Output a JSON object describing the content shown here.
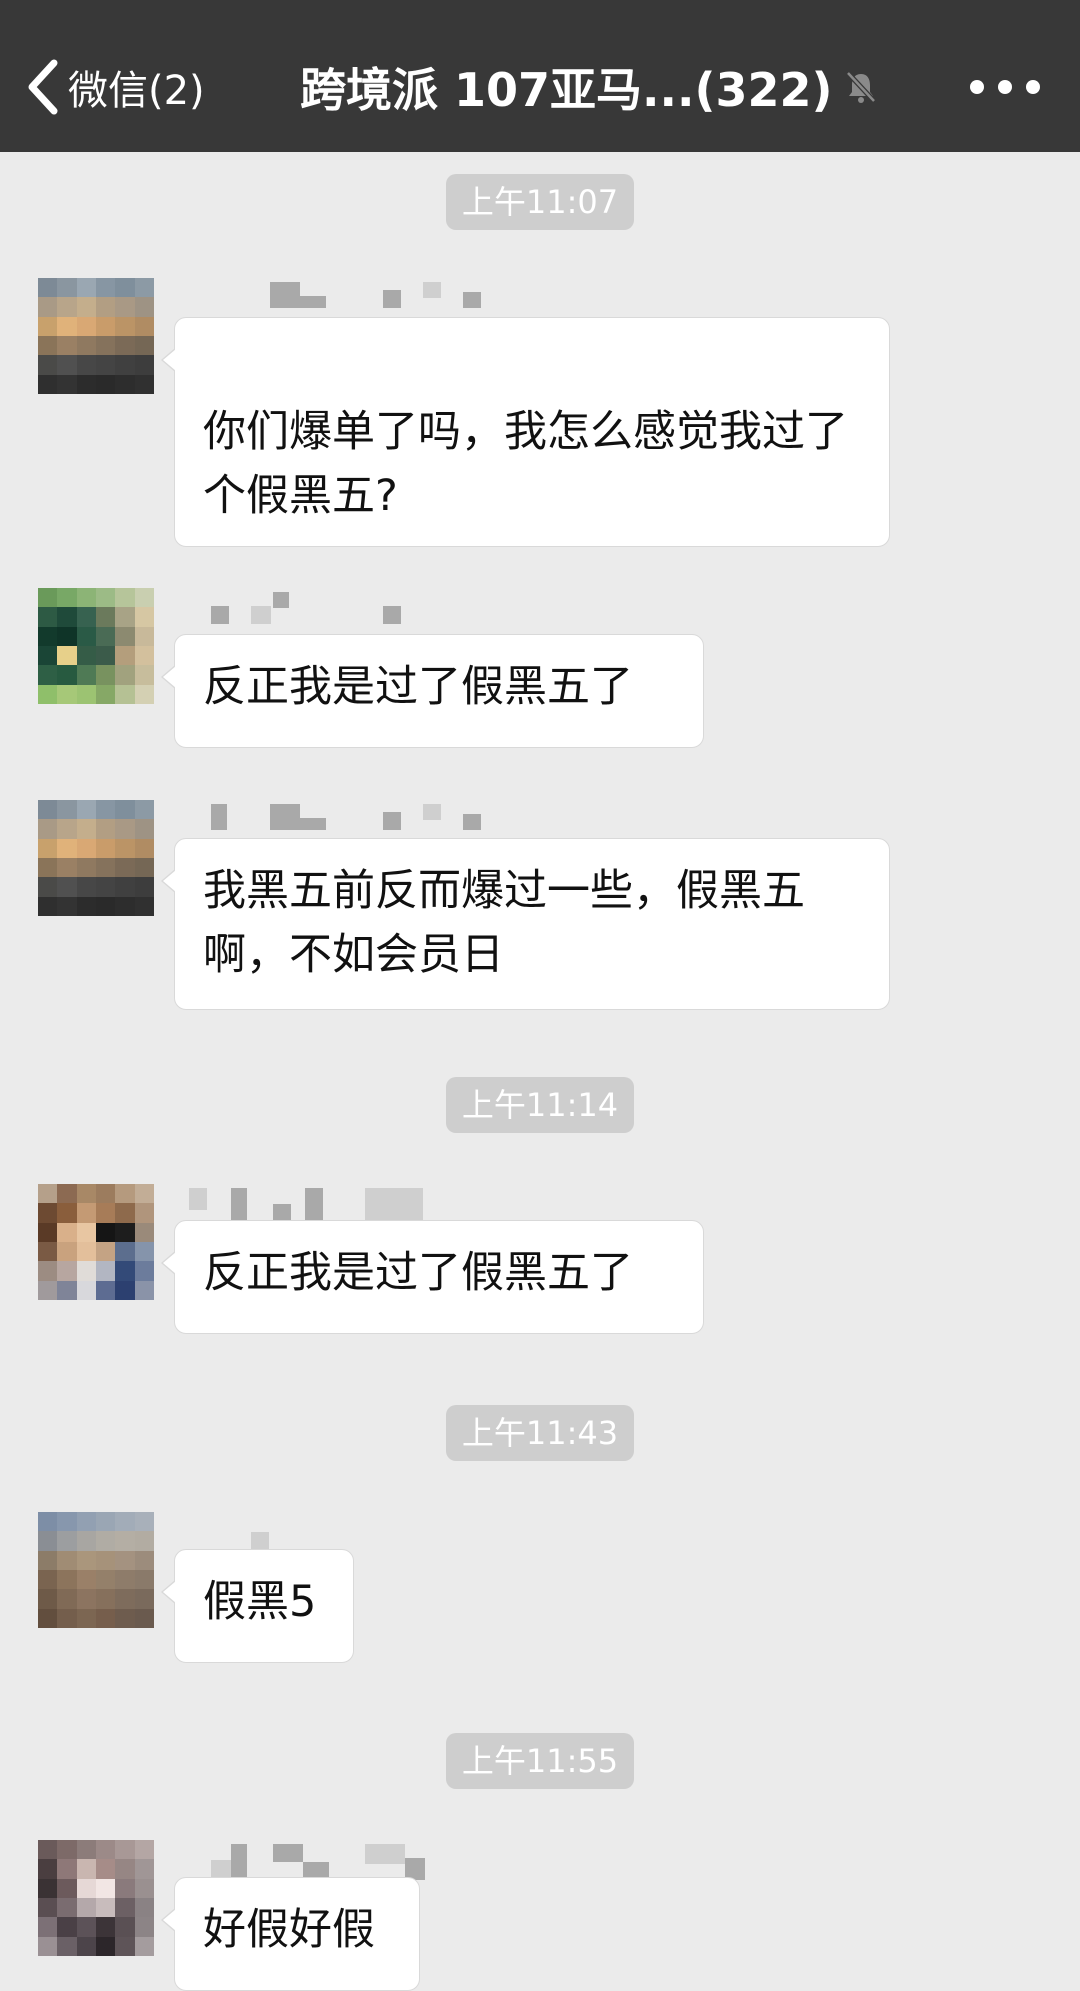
{
  "navbar": {
    "back_label": "微信(2)",
    "title": "跨境派 107亚马...(322)",
    "icons": {
      "back": "chevron-left-icon",
      "mute": "bell-muted-icon",
      "more": "more-dots-icon"
    }
  },
  "timestamps": [
    "上午11:07",
    "上午11:14",
    "上午11:43",
    "上午11:55"
  ],
  "messages": [
    {
      "text": "你们爆单了吗，我怎么感觉我过了个假黑五?"
    },
    {
      "text": "反正我是过了假黑五了"
    },
    {
      "text": "我黑五前反而爆过一些，假黑五啊，不如会员日"
    },
    {
      "text": "反正我是过了假黑五了"
    },
    {
      "text": "假黑5"
    },
    {
      "text": "好假好假"
    }
  ],
  "colors": {
    "navbar": "#383838",
    "background": "#ebebeb",
    "bubble": "#ffffff",
    "timestamp_bg": "#cecece"
  }
}
